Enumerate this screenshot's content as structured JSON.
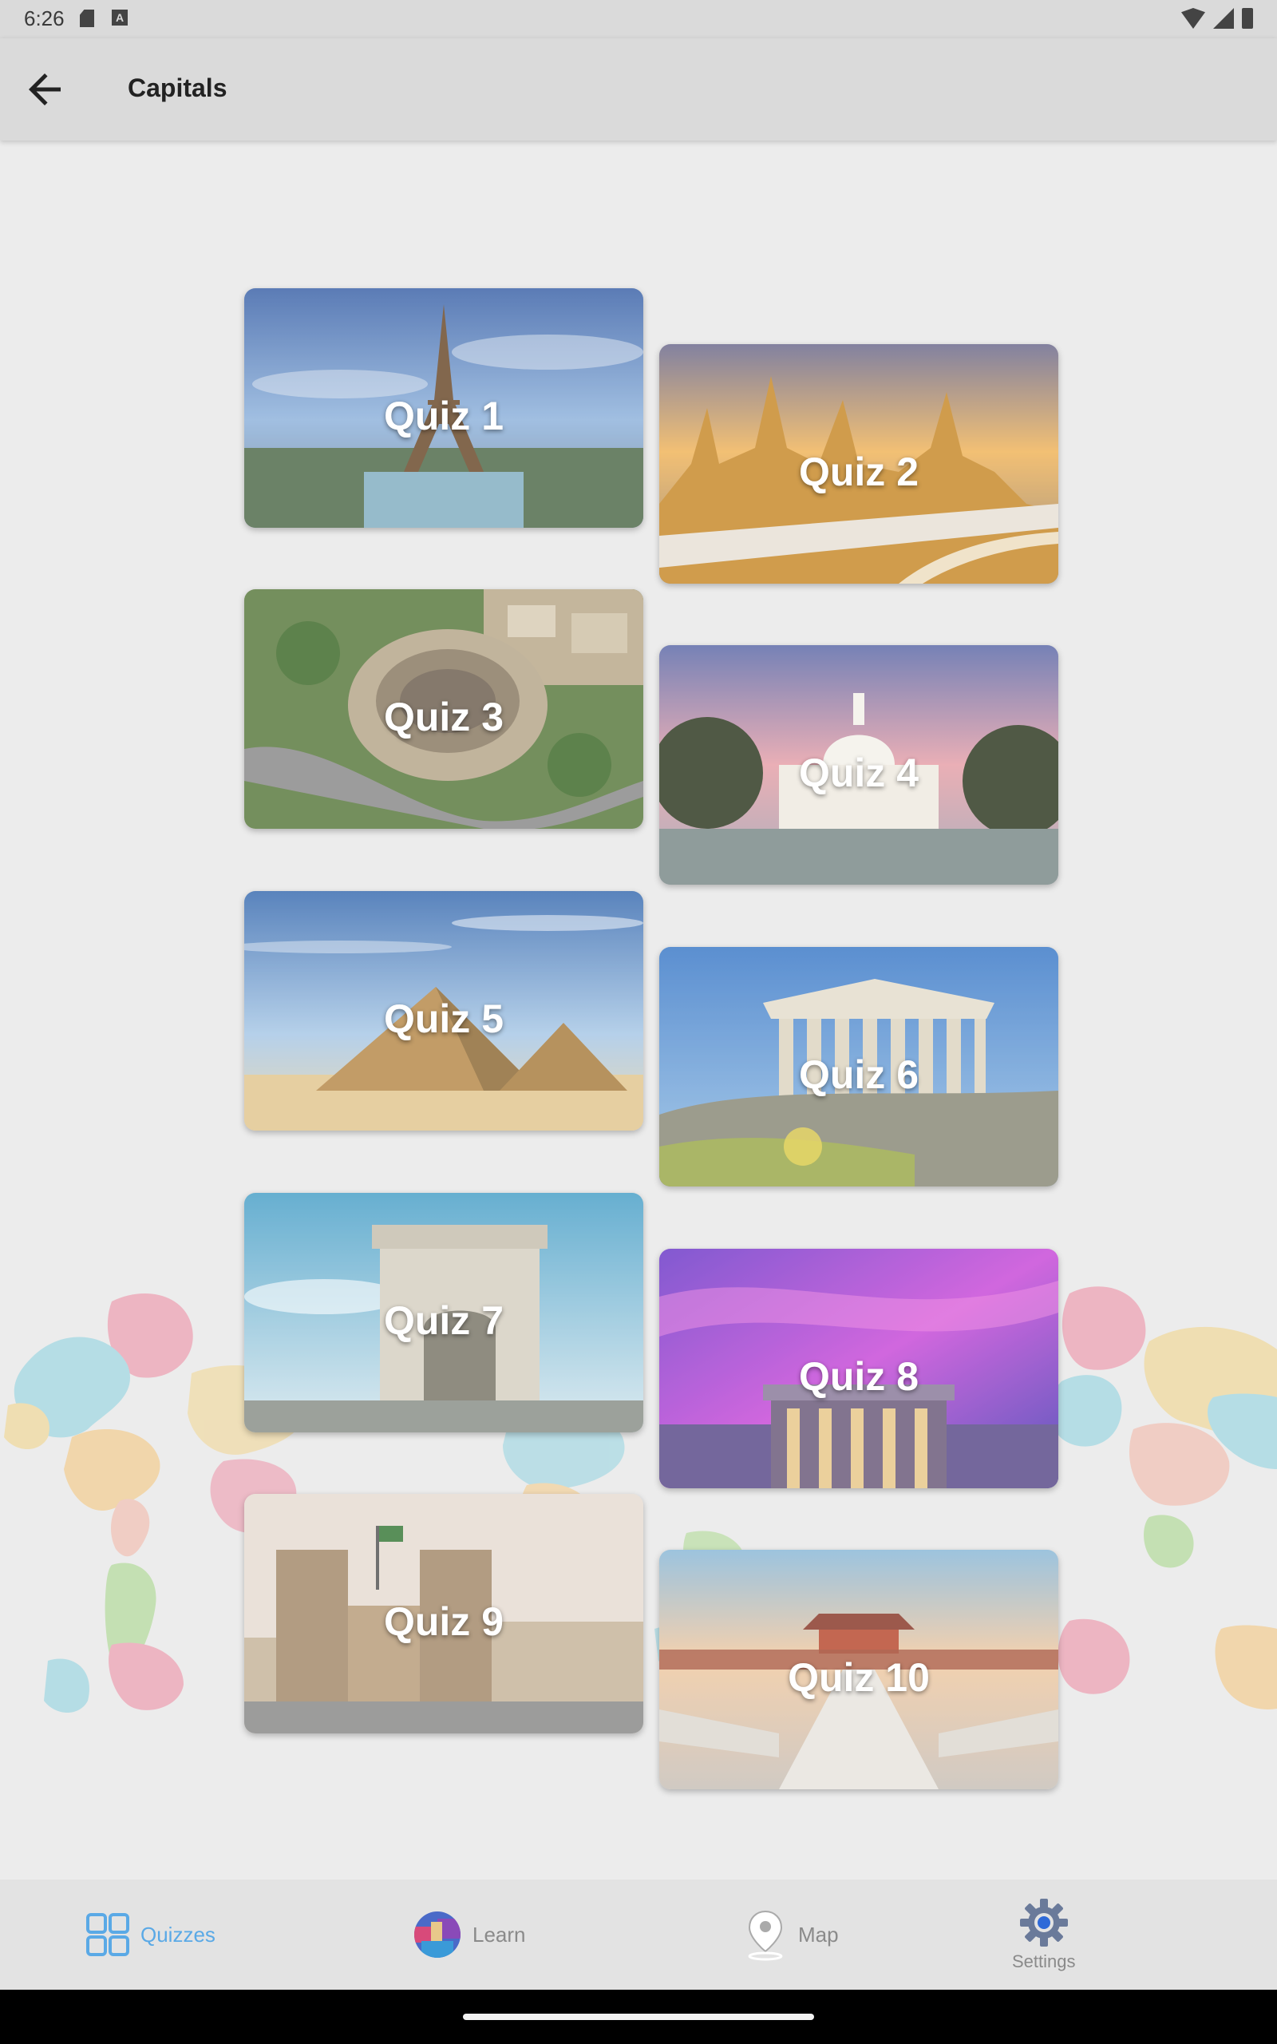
{
  "status_bar": {
    "time": "6:26",
    "a_icon_letter": "A"
  },
  "app_bar": {
    "title": "Capitals"
  },
  "quizzes": [
    {
      "label": "Quiz 1",
      "scene": "eiffel-tower"
    },
    {
      "label": "Quiz 2",
      "scene": "grand-palace"
    },
    {
      "label": "Quiz 3",
      "scene": "colosseum"
    },
    {
      "label": "Quiz 4",
      "scene": "capitol"
    },
    {
      "label": "Quiz 5",
      "scene": "pyramids"
    },
    {
      "label": "Quiz 6",
      "scene": "parthenon"
    },
    {
      "label": "Quiz 7",
      "scene": "arc-de-triomphe"
    },
    {
      "label": "Quiz 8",
      "scene": "brandenburg-gate"
    },
    {
      "label": "Quiz 9",
      "scene": "metropolitan-cathedral"
    },
    {
      "label": "Quiz 10",
      "scene": "forbidden-city"
    }
  ],
  "bottom_nav": {
    "quizzes": "Quizzes",
    "learn": "Learn",
    "map": "Map",
    "settings": "Settings",
    "active_color": "#5aa9e6",
    "inactive_color": "#8a8a8a"
  }
}
